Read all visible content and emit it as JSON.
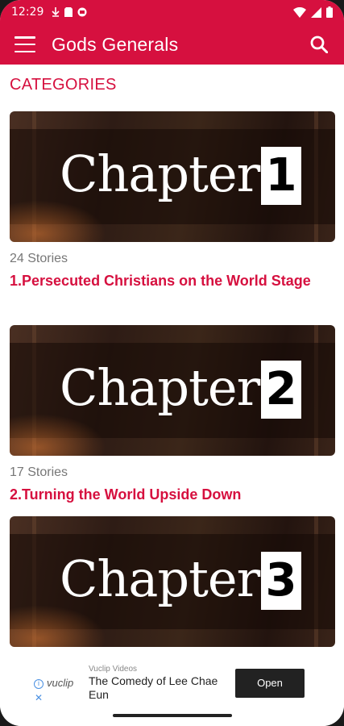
{
  "status_bar": {
    "time": "12:29"
  },
  "app_bar": {
    "title": "Gods Generals"
  },
  "section": {
    "title": "CATEGORIES"
  },
  "chapters": [
    {
      "word": "Chapter",
      "number": "1",
      "count": "24 Stories",
      "title": "1.Persecuted Christians on the World Stage"
    },
    {
      "word": "Chapter",
      "number": "2",
      "count": "17 Stories",
      "title": "2.Turning the World Upside Down"
    },
    {
      "word": "Chapter",
      "number": "3",
      "count": "",
      "title": ""
    }
  ],
  "ad": {
    "source": "Vuclip Videos",
    "logo": "vuclip",
    "text": "The Comedy of Lee Chae Eun",
    "button": "Open"
  },
  "colors": {
    "accent": "#d6103f"
  },
  "icons": [
    "menu-icon",
    "search-icon",
    "wifi-icon",
    "signal-icon",
    "info-icon",
    "close-icon"
  ]
}
